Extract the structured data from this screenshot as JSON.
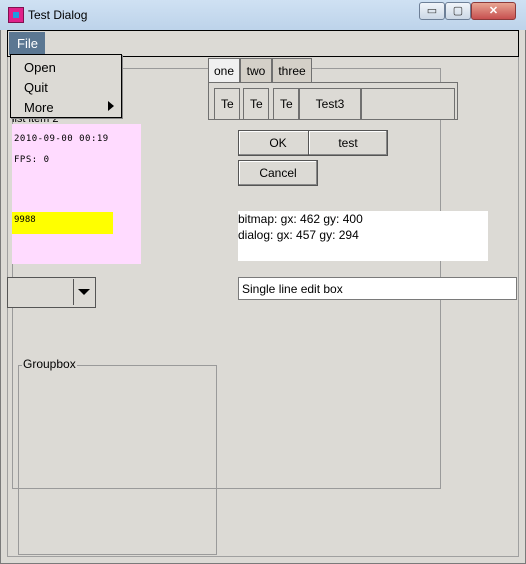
{
  "window": {
    "title": "Test Dialog",
    "min_glyph": "▭",
    "max_glyph": "▢",
    "close_glyph": "✕"
  },
  "menubar": {
    "file_label": "File"
  },
  "file_menu": {
    "items": [
      "Open",
      "Quit",
      "More"
    ]
  },
  "tabs": [
    "one",
    "two",
    "three"
  ],
  "tab_buttons": [
    "Te",
    "Te",
    "Te",
    "Test3",
    ""
  ],
  "buttons": {
    "ok": "OK",
    "test": "test",
    "cancel": "Cancel"
  },
  "list_label": "list item 2",
  "pink_panel": {
    "line1": "2010-09-00 00:19",
    "line2": "FPS: 0",
    "yellow_text": "9988"
  },
  "status": {
    "line1": "bitmap: gx: 462 gy: 400",
    "line2": "dialog: gx: 457 gy: 294"
  },
  "edit_box": {
    "value": "Single line edit box"
  },
  "groupbox": {
    "label": "Groupbox"
  },
  "colors": {
    "menu_highlight": "#5b7792",
    "pink_canvas": "#ffdbff",
    "yellow_highlight": "#ffff00",
    "window_bg": "#dcdad5"
  }
}
